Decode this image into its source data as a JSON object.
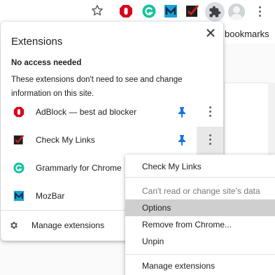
{
  "toolbar": {
    "icons": [
      "star-icon",
      "adblock-icon",
      "grammarly-icon",
      "mozbar-icon",
      "check-my-links-icon",
      "puzzle-icon",
      "avatar",
      "more-vert-icon"
    ]
  },
  "bookmarks_bar": {
    "label": "bookmarks"
  },
  "extensions_popup": {
    "title": "Extensions",
    "section_header": "No access needed",
    "section_description": "These extensions don't need to see and change information on this site.",
    "items": [
      {
        "name": "AdBlock — best ad blocker",
        "icon": "adblock-icon",
        "pinned": true
      },
      {
        "name": "Check My Links",
        "icon": "check-my-links-icon",
        "pinned": true
      },
      {
        "name": "Grammarly for Chrome",
        "icon": "grammarly-icon",
        "pinned": false
      },
      {
        "name": "MozBar",
        "icon": "mozbar-icon",
        "pinned": false
      }
    ],
    "manage_label": "Manage extensions"
  },
  "context_menu": {
    "title": "Check My Links",
    "no_access": "Can't read or change site's data",
    "options": "Options",
    "remove": "Remove from Chrome...",
    "unpin": "Unpin",
    "manage": "Manage extensions"
  },
  "colors": {
    "pin_blue": "#1a73e8",
    "adblock_red": "#d9001b",
    "grammarly_green": "#15c39a",
    "mozbar_blue": "#1da1d3"
  }
}
